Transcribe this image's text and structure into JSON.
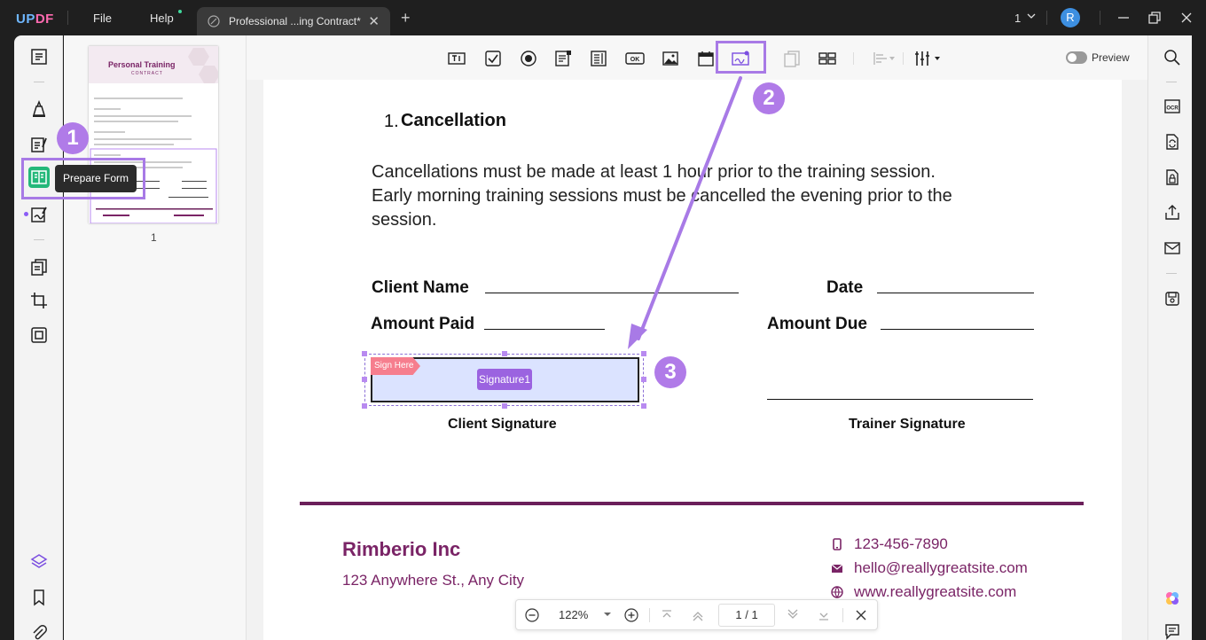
{
  "app": {
    "logo": "UPDF",
    "menu": {
      "file": "File",
      "help": "Help"
    },
    "tab_title": "Professional ...ing Contract*",
    "page_indicator": "1",
    "avatar_initial": "R"
  },
  "sidebar": {
    "tooltip": "Prepare Form",
    "icons": [
      "reader-icon",
      "comment-icon",
      "edit-icon",
      "prepare-form-icon",
      "sign-icon",
      "organize-icon",
      "crop-icon",
      "convert-icon",
      "layers-icon",
      "bookmark-icon",
      "attachment-icon"
    ]
  },
  "thumbnail": {
    "page_number": "1",
    "title": "Personal Training",
    "subtitle": "CONTRACT"
  },
  "toolbar": {
    "tools": [
      "text-field-tool",
      "checkbox-tool",
      "radio-button-tool",
      "combo-box-tool",
      "list-box-tool",
      "button-tool",
      "image-tool",
      "date-field-tool",
      "signature-field-tool",
      "duplicate-tool",
      "multiple-tool",
      "align-tool",
      "more-tools"
    ],
    "preview_label": "Preview"
  },
  "document": {
    "section_number": "1.",
    "section_title": "Cancellation",
    "paragraph_lines": [
      "Cancellations must be made at least 1 hour prior to the training session.",
      "Early morning training sessions must be cancelled the evening prior to the",
      "session."
    ],
    "fields": {
      "client_name": "Client Name",
      "date": "Date",
      "amount_paid": "Amount Paid",
      "amount_due": "Amount Due",
      "client_signature": "Client Signature",
      "trainer_signature": "Trainer Signature"
    },
    "signature_field": {
      "tag": "Sign Here",
      "name": "Signature1"
    },
    "footer": {
      "company": "Rimberio Inc",
      "address": "123 Anywhere St., Any City",
      "phone": "123-456-7890",
      "email": "hello@reallygreatsite.com",
      "website": "www.reallygreatsite.com"
    }
  },
  "bottom_nav": {
    "zoom": "122%",
    "current_page": "1",
    "page_sep": "/",
    "total_pages": "1"
  },
  "annotations": {
    "step1": "1",
    "step2": "2",
    "step3": "3",
    "highlight_color": "#a87ae6"
  }
}
